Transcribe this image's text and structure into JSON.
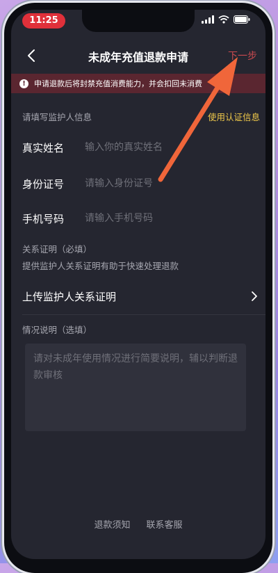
{
  "status_bar": {
    "time": "11:25"
  },
  "nav": {
    "title": "未成年充值退款申请",
    "next": "下一步"
  },
  "banner": {
    "text": "申请退款后将封禁充值消费能力，并会扣回未消费"
  },
  "guardian": {
    "heading": "请填写监护人信息",
    "use_cert": "使用认证信息",
    "fields": [
      {
        "label": "真实姓名",
        "placeholder": "输入你的真实姓名"
      },
      {
        "label": "身份证号",
        "placeholder": "请输入身份证号"
      },
      {
        "label": "手机号码",
        "placeholder": "请输入手机号码"
      }
    ]
  },
  "relation": {
    "heading": "关系证明（必填）",
    "hint": "提供监护人关系证明有助于快速处理退款",
    "upload_label": "上传监护人关系证明"
  },
  "situation": {
    "heading": "情况说明（选填）",
    "placeholder": "请对未成年使用情况进行简要说明，辅以判断退款审核"
  },
  "footer": {
    "refund_notice": "退款须知",
    "contact_support": "联系客服"
  },
  "colors": {
    "accent_arrow": "#f0663a",
    "banner_bg": "#5a2630",
    "link_yellow": "#f0c94a",
    "next_red": "#c94a4f"
  },
  "icons": [
    "back-icon",
    "signal-icon",
    "wifi-icon",
    "battery-icon",
    "warning-icon",
    "chevron-right-icon"
  ]
}
